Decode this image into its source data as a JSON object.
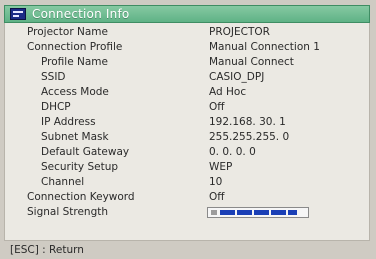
{
  "window": {
    "title": "Connection Info",
    "icon": "info-window-icon"
  },
  "rows": [
    {
      "label": "Projector Name",
      "value": "PROJECTOR",
      "indent": 0
    },
    {
      "label": "Connection Profile",
      "value": "Manual Connection 1",
      "indent": 0
    },
    {
      "label": "Profile Name",
      "value": "Manual Connect",
      "indent": 1
    },
    {
      "label": "SSID",
      "value": "CASIO_DPJ",
      "indent": 1
    },
    {
      "label": "Access Mode",
      "value": "Ad Hoc",
      "indent": 1
    },
    {
      "label": "DHCP",
      "value": "Off",
      "indent": 1
    },
    {
      "label": "IP Address",
      "value": "192.168. 30. 1",
      "indent": 1
    },
    {
      "label": "Subnet Mask",
      "value": "255.255.255. 0",
      "indent": 1
    },
    {
      "label": "Default Gateway",
      "value": " 0. 0. 0. 0",
      "indent": 1
    },
    {
      "label": "Security Setup",
      "value": "WEP",
      "indent": 1
    },
    {
      "label": "Channel",
      "value": "10",
      "indent": 1
    },
    {
      "label": "Connection Keyword",
      "value": "Off",
      "indent": 0
    }
  ],
  "signal": {
    "label": "Signal Strength",
    "level_fraction": 0.9
  },
  "footer": {
    "hint": "[ESC] : Return"
  },
  "colors": {
    "title_bar": "#6fbd91",
    "panel": "#ebe9e3",
    "signal_bar": "#1a3fb6"
  }
}
